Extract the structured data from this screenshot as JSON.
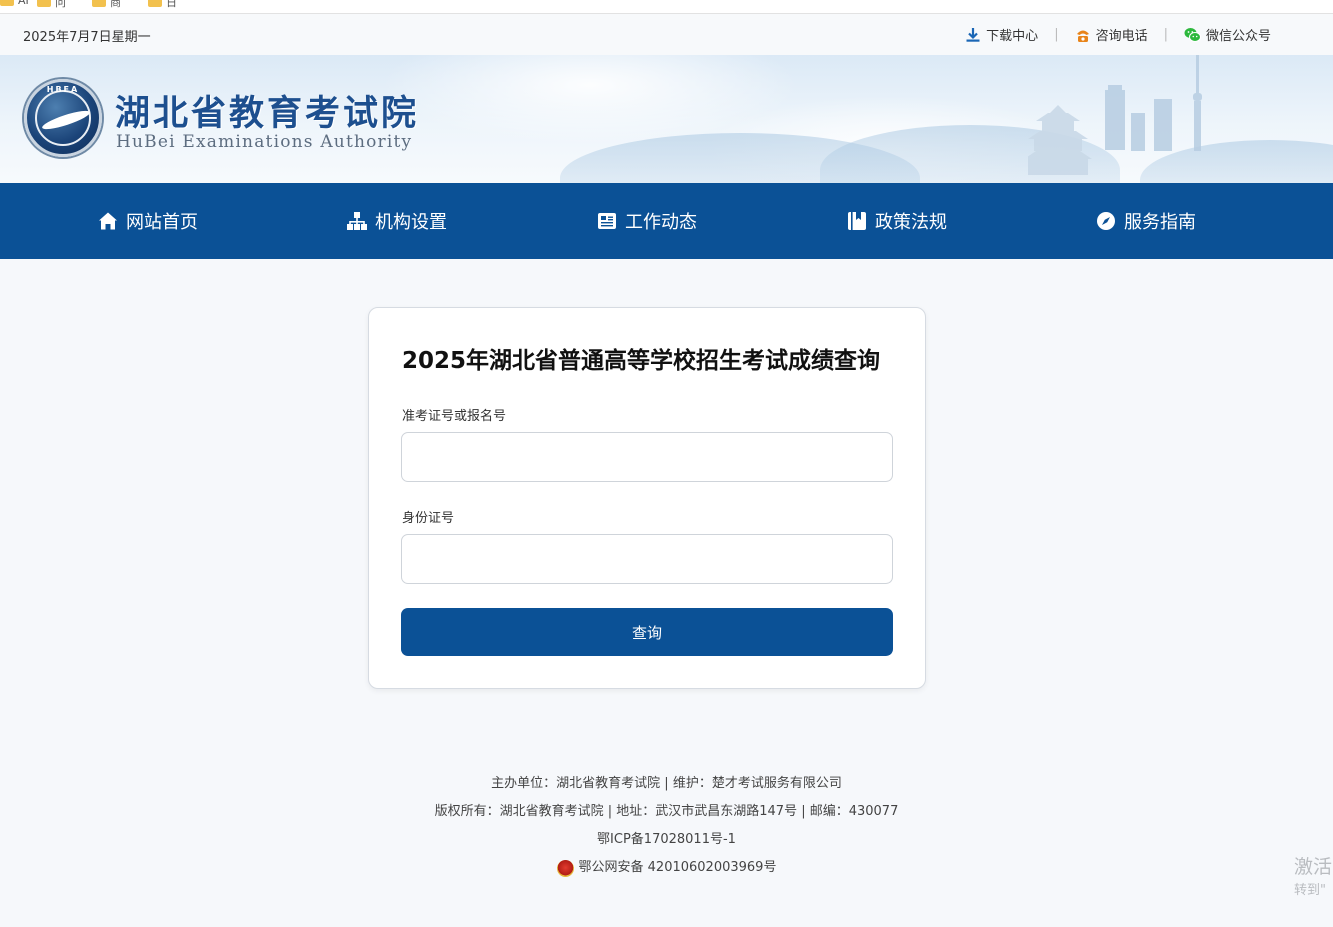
{
  "bookmarks": [
    "AI",
    "问 ",
    "商 ",
    "日 "
  ],
  "topbar": {
    "date": "2025年7月7日星期一",
    "links": {
      "download": "下载中心",
      "phone": "咨询电话",
      "wechat": "微信公众号"
    }
  },
  "banner": {
    "title": "湖北省教育考试院",
    "subtitle": "HuBei Examinations Authority",
    "emblem_letters": "HBEA"
  },
  "nav": {
    "home": "网站首页",
    "org": "机构设置",
    "news": "工作动态",
    "policy": "政策法规",
    "guide": "服务指南"
  },
  "form": {
    "title": "2025年湖北省普通高等学校招生考试成绩查询",
    "exam_label": "准考证号或报名号",
    "exam_value": "",
    "id_label": "身份证号",
    "id_value": "",
    "submit_label": "查询"
  },
  "footer": {
    "line1": "主办单位：湖北省教育考试院 | 维护：楚才考试服务有限公司",
    "line2": "版权所有：湖北省教育考试院 | 地址：武汉市武昌东湖路147号 | 邮编：430077",
    "icp": "鄂ICP备17028011号-1",
    "police": "鄂公网安备 42010602003969号"
  },
  "watermark": {
    "line1": "激活",
    "line2": "转到\""
  },
  "colors": {
    "primary": "#0b5196",
    "title_blue": "#1d4f8f",
    "download_icon": "#1a66b5",
    "phone_icon": "#e8841a",
    "wechat_icon": "#2db83d"
  }
}
